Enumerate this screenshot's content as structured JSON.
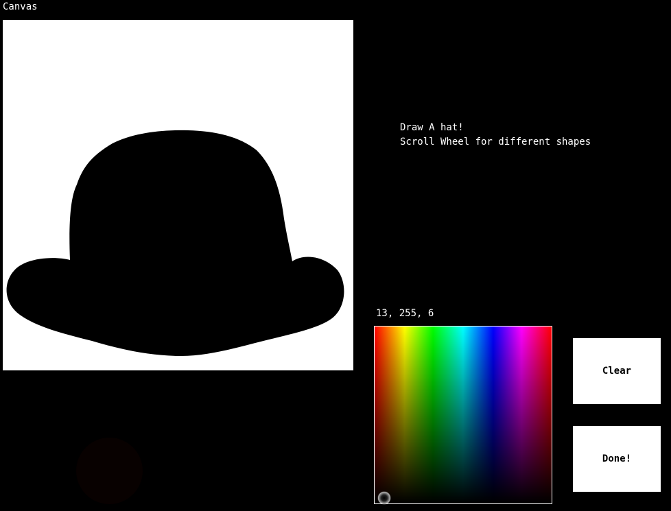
{
  "canvas": {
    "title": "Canvas",
    "background_color": "#ffffff",
    "drawing_color": "#000000",
    "drawing_shape": "bowler-hat"
  },
  "instructions": {
    "line1": "Draw A hat!",
    "line2": "Scroll Wheel for different shapes"
  },
  "color_picker": {
    "rgb_readout": "13, 255, 6",
    "selected_hue_fraction": 0.0,
    "selected_brightness_fraction": 0.0
  },
  "buttons": {
    "clear_label": "Clear",
    "done_label": "Done!"
  },
  "brush": {
    "shape": "circle",
    "color": "#080100"
  }
}
